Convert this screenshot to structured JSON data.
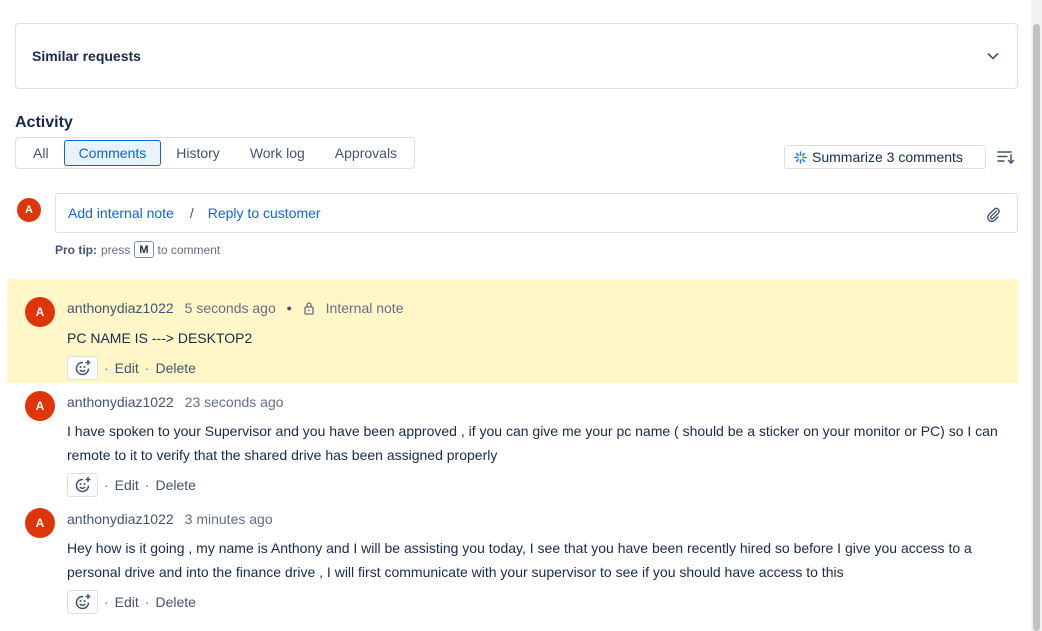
{
  "similar_requests": {
    "title": "Similar requests",
    "icon": "chevron-down-icon"
  },
  "activity": {
    "title": "Activity",
    "tabs": [
      {
        "label": "All",
        "active": false
      },
      {
        "label": "Comments",
        "active": true
      },
      {
        "label": "History",
        "active": false
      },
      {
        "label": "Work log",
        "active": false
      },
      {
        "label": "Approvals",
        "active": false
      }
    ],
    "summarize_label": "Summarize 3 comments",
    "sort_icon": "sort-icon"
  },
  "composer": {
    "avatar_initial": "A",
    "internal_note_label": "Add internal note",
    "separator": "/",
    "reply_label": "Reply to customer",
    "attach_icon": "paperclip-icon"
  },
  "protip": {
    "label": "Pro tip:",
    "before": "press",
    "key": "M",
    "after": "to comment"
  },
  "comments": [
    {
      "avatar_initial": "A",
      "author": "anthonydiaz1022",
      "time": "5 seconds ago",
      "dot": "•",
      "type": "Internal note",
      "highlighted": true,
      "body": "PC NAME IS ---> DESKTOP2",
      "edit_label": "Edit",
      "delete_label": "Delete"
    },
    {
      "avatar_initial": "A",
      "author": "anthonydiaz1022",
      "time": "23 seconds ago",
      "highlighted": false,
      "body": "I have spoken to your Supervisor and you have been approved , if you can give me your pc name ( should be a sticker on your monitor or PC) so I can remote to it to verify that the shared drive has been assigned properly",
      "edit_label": "Edit",
      "delete_label": "Delete"
    },
    {
      "avatar_initial": "A",
      "author": "anthonydiaz1022",
      "time": "3 minutes ago",
      "highlighted": false,
      "body": "Hey how is it going , my name is Anthony and I will be assisting you today, I see that you have been recently hired so before I give you access to a personal drive and into the finance drive , I will first communicate with your supervisor to see if you should have access to this",
      "edit_label": "Edit",
      "delete_label": "Delete"
    }
  ],
  "action_separator": "·",
  "colors": {
    "accent": "#0c66e4",
    "avatar": "#de350b",
    "highlight": "#fff7c7"
  }
}
